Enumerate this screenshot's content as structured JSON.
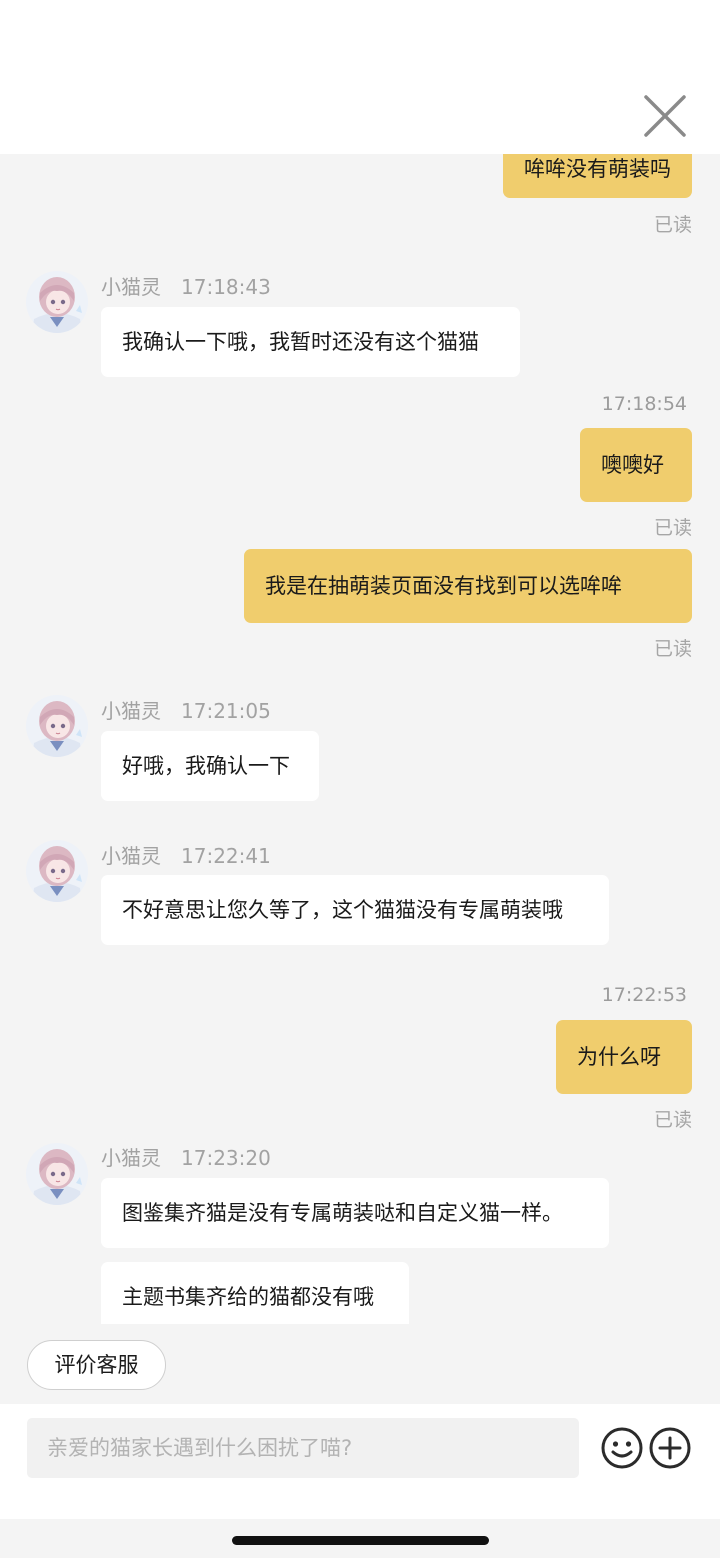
{
  "header": {
    "close_icon": "close-icon"
  },
  "messages": {
    "m0": {
      "text": "哞哞没有萌装吗",
      "read": "已读"
    },
    "m1": {
      "name": "小猫灵",
      "time": "17:18:43",
      "text": "我确认一下哦，我暂时还没有这个猫猫"
    },
    "m2": {
      "time": "17:18:54",
      "text": "噢噢好",
      "read": "已读"
    },
    "m3": {
      "text": "我是在抽萌装页面没有找到可以选哞哞",
      "read": "已读"
    },
    "m4": {
      "name": "小猫灵",
      "time": "17:21:05",
      "text": "好哦，我确认一下"
    },
    "m5": {
      "name": "小猫灵",
      "time": "17:22:41",
      "text": "不好意思让您久等了，这个猫猫没有专属萌装哦"
    },
    "m6": {
      "time": "17:22:53",
      "text": "为什么呀",
      "read": "已读"
    },
    "m7": {
      "name": "小猫灵",
      "time": "17:23:20",
      "text": "图鉴集齐猫是没有专属萌装哒和自定义猫一样。"
    },
    "m8": {
      "text": "主题书集齐给的猫都没有哦"
    }
  },
  "rate_button": "评价客服",
  "input": {
    "placeholder": "亲爱的猫家长遇到什么困扰了喵?"
  },
  "icons": {
    "emoji": "emoji-icon",
    "plus": "plus-circle-icon"
  },
  "colors": {
    "user_bubble": "#f0cd6d",
    "agent_bubble": "#ffffff",
    "background": "#f4f4f4"
  }
}
